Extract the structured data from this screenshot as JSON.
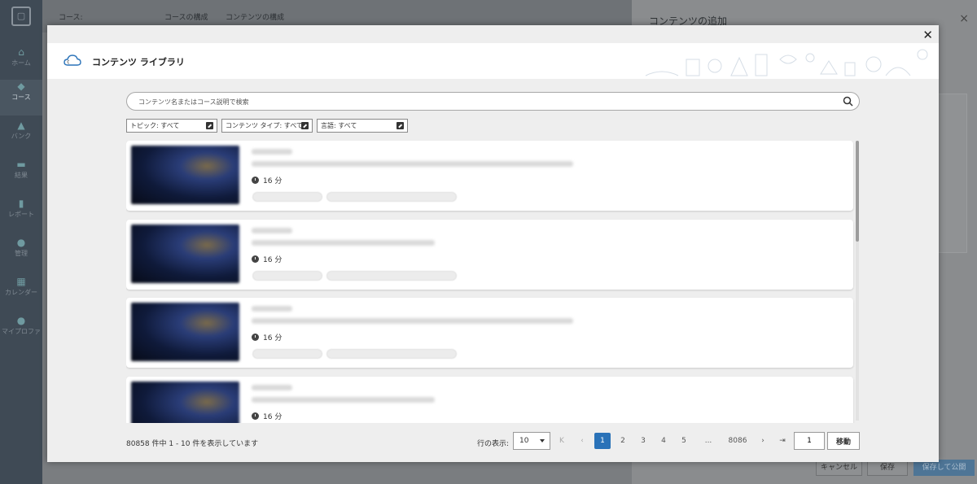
{
  "sidebar": {
    "items": [
      {
        "label": "ホーム",
        "icon": "home-icon"
      },
      {
        "label": "コース",
        "icon": "course-icon"
      },
      {
        "label": "バンク",
        "icon": "bank-icon"
      },
      {
        "label": "結果",
        "icon": "results-icon"
      },
      {
        "label": "レポート",
        "icon": "report-icon"
      },
      {
        "label": "管理",
        "icon": "admin-icon"
      },
      {
        "label": "カレンダー",
        "icon": "calendar-icon"
      },
      {
        "label": "マイプロファ",
        "icon": "profile-icon"
      }
    ]
  },
  "topbar": {
    "crumb1": "コース:",
    "crumb2": "コースの構成",
    "crumb3": "コンテンツの構成"
  },
  "right_panel": {
    "title": "コンテンツの追加",
    "cancel": "キャンセル",
    "save": "保存",
    "save_publish": "保存して公開"
  },
  "modal": {
    "title": "コンテンツ ライブラリ",
    "search_placeholder": "コンテンツ名またはコース説明で検索",
    "filters": [
      {
        "label": "トピック: すべて"
      },
      {
        "label": "コンテンツ タイプ: すべて"
      },
      {
        "label": "言語: すべて"
      }
    ],
    "items": [
      {
        "duration": "16 分"
      },
      {
        "duration": "16 分"
      },
      {
        "duration": "16 分"
      },
      {
        "duration": "16 分"
      }
    ],
    "footer": {
      "count_text": "80858 件中 1 - 10 件を表示しています",
      "rows_label": "行の表示:",
      "rows_value": "10",
      "pages": [
        "1",
        "2",
        "3",
        "4",
        "5",
        "...",
        "8086"
      ],
      "current_page": "1",
      "page_input": "1",
      "go_label": "移動"
    }
  },
  "colors": {
    "accent": "#2a72b8",
    "sidebar_bg": "#3f4a55"
  }
}
